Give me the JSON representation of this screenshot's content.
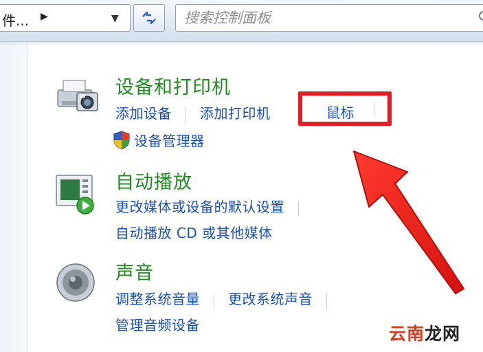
{
  "topbar": {
    "address_text": "件...",
    "search_placeholder": "搜索控制面板"
  },
  "devices": {
    "title": "设备和打印机",
    "links": [
      "添加设备",
      "添加打印机",
      "鼠标"
    ],
    "admin_link": "设备管理器"
  },
  "autoplay": {
    "title": "自动播放",
    "links": [
      "更改媒体或设备的默认设置",
      "自动播放 CD 或其他媒体"
    ]
  },
  "sound": {
    "title": "声音",
    "links": [
      "调整系统音量",
      "更改系统声音",
      "管理音频设备"
    ]
  },
  "annotation": {
    "highlight_color": "#e51c23"
  },
  "watermark": {
    "part1": "云南",
    "part2": "龙网"
  },
  "colors": {
    "title_green": "#1e8c1e",
    "link_blue": "#1a51b5"
  }
}
